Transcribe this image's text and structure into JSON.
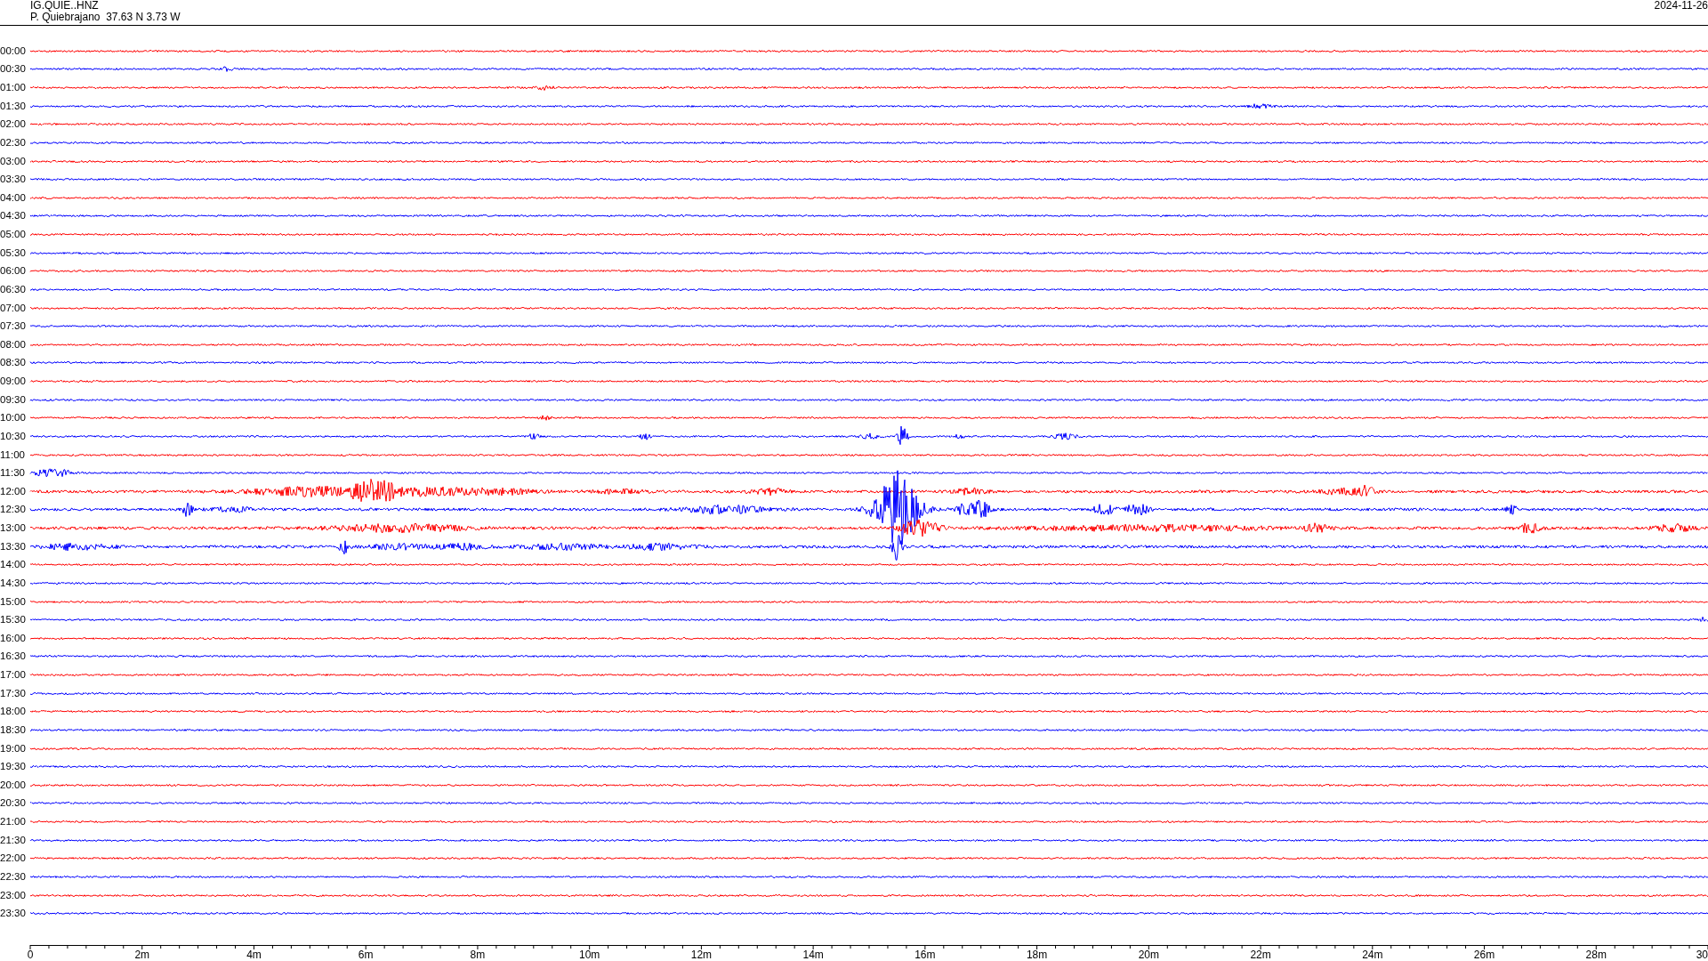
{
  "header": {
    "station": "IG.QUIE..HNZ",
    "location": "P. Quiebrajano  37.63 N 3.73 W",
    "date": "2024-11-26"
  },
  "traces": [
    {
      "time": "00:00",
      "color": "#ff0000"
    },
    {
      "time": "00:30",
      "color": "#0000ff"
    },
    {
      "time": "01:00",
      "color": "#ff0000"
    },
    {
      "time": "01:30",
      "color": "#0000ff"
    },
    {
      "time": "02:00",
      "color": "#ff0000"
    },
    {
      "time": "02:30",
      "color": "#0000ff"
    },
    {
      "time": "03:00",
      "color": "#ff0000"
    },
    {
      "time": "03:30",
      "color": "#0000ff"
    },
    {
      "time": "04:00",
      "color": "#ff0000"
    },
    {
      "time": "04:30",
      "color": "#0000ff"
    },
    {
      "time": "05:00",
      "color": "#ff0000"
    },
    {
      "time": "05:30",
      "color": "#0000ff"
    },
    {
      "time": "06:00",
      "color": "#ff0000"
    },
    {
      "time": "06:30",
      "color": "#0000ff"
    },
    {
      "time": "07:00",
      "color": "#ff0000"
    },
    {
      "time": "07:30",
      "color": "#0000ff"
    },
    {
      "time": "08:00",
      "color": "#ff0000"
    },
    {
      "time": "08:30",
      "color": "#0000ff"
    },
    {
      "time": "09:00",
      "color": "#ff0000"
    },
    {
      "time": "09:30",
      "color": "#0000ff"
    },
    {
      "time": "10:00",
      "color": "#ff0000"
    },
    {
      "time": "10:30",
      "color": "#0000ff"
    },
    {
      "time": "11:00",
      "color": "#ff0000"
    },
    {
      "time": "11:30",
      "color": "#0000ff"
    },
    {
      "time": "12:00",
      "color": "#ff0000"
    },
    {
      "time": "12:30",
      "color": "#0000ff"
    },
    {
      "time": "13:00",
      "color": "#ff0000"
    },
    {
      "time": "13:30",
      "color": "#0000ff"
    },
    {
      "time": "14:00",
      "color": "#ff0000"
    },
    {
      "time": "14:30",
      "color": "#0000ff"
    },
    {
      "time": "15:00",
      "color": "#ff0000"
    },
    {
      "time": "15:30",
      "color": "#0000ff"
    },
    {
      "time": "16:00",
      "color": "#ff0000"
    },
    {
      "time": "16:30",
      "color": "#0000ff"
    },
    {
      "time": "17:00",
      "color": "#ff0000"
    },
    {
      "time": "17:30",
      "color": "#0000ff"
    },
    {
      "time": "18:00",
      "color": "#ff0000"
    },
    {
      "time": "18:30",
      "color": "#0000ff"
    },
    {
      "time": "19:00",
      "color": "#ff0000"
    },
    {
      "time": "19:30",
      "color": "#0000ff"
    },
    {
      "time": "20:00",
      "color": "#ff0000"
    },
    {
      "time": "20:30",
      "color": "#0000ff"
    },
    {
      "time": "21:00",
      "color": "#ff0000"
    },
    {
      "time": "21:30",
      "color": "#0000ff"
    },
    {
      "time": "22:00",
      "color": "#ff0000"
    },
    {
      "time": "22:30",
      "color": "#0000ff"
    },
    {
      "time": "23:00",
      "color": "#ff0000"
    },
    {
      "time": "23:30",
      "color": "#0000ff"
    }
  ],
  "time_axis": {
    "labels": [
      "0",
      "2m",
      "4m",
      "6m",
      "8m",
      "10m",
      "12m",
      "14m",
      "16m",
      "18m",
      "20m",
      "22m",
      "24m",
      "26m",
      "28m",
      "30"
    ]
  }
}
